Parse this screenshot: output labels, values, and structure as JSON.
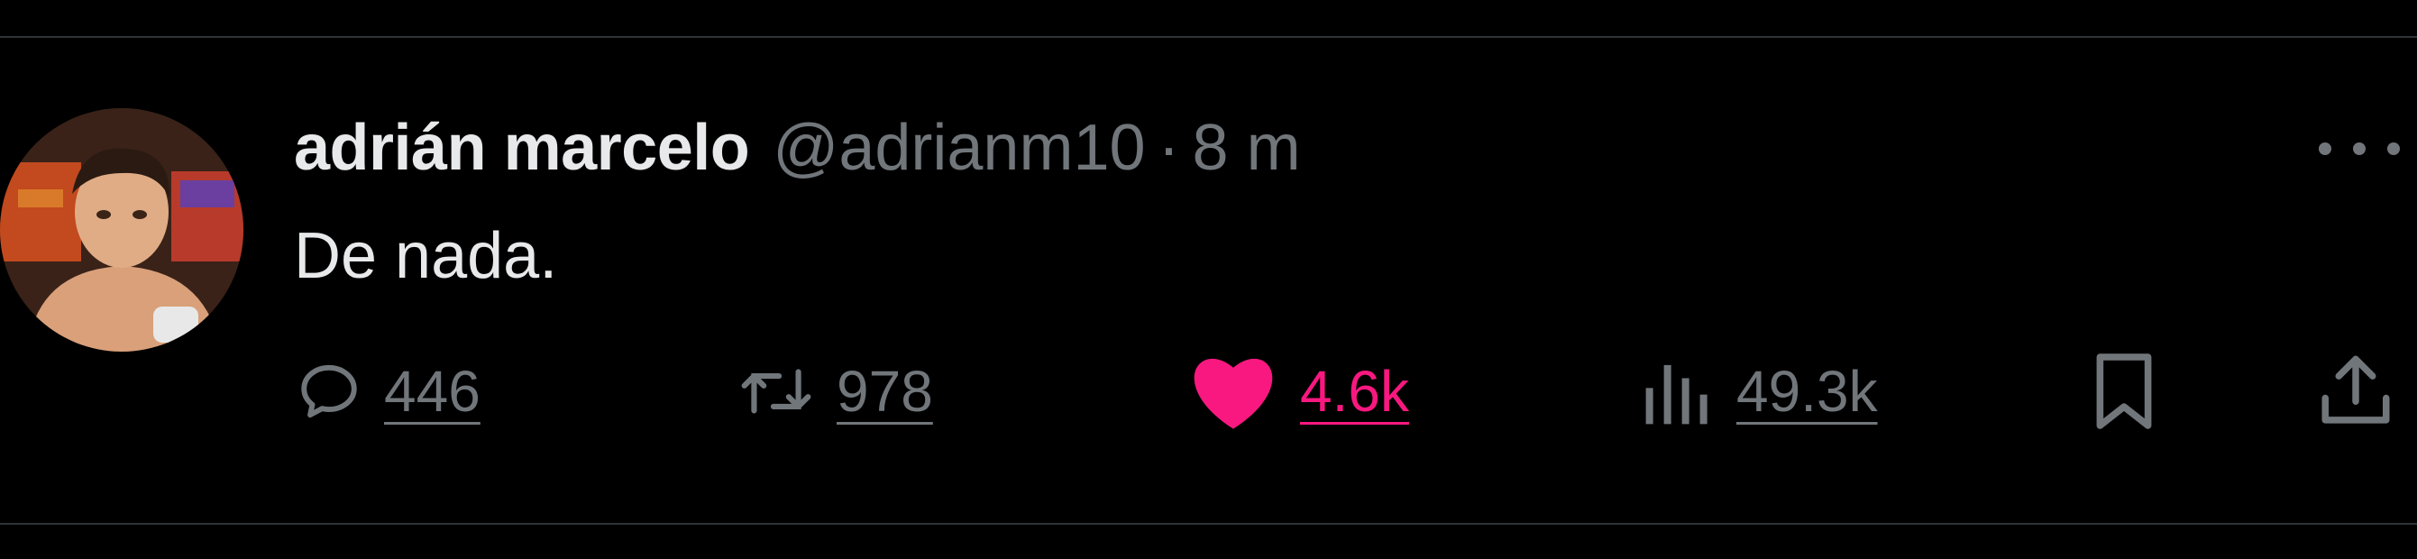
{
  "tweet": {
    "author": {
      "display_name": "adrián marcelo",
      "handle": "@adrianm10",
      "separator": "·",
      "time": "8 m"
    },
    "text": "De nada.",
    "actions": {
      "replies": "446",
      "reposts": "978",
      "likes": "4.6k",
      "views": "49.3k"
    },
    "liked": true
  },
  "colors": {
    "background": "#000000",
    "text_primary": "#e7e9ea",
    "text_secondary": "#71767b",
    "like_active": "#f91880",
    "divider": "#2f3336"
  },
  "icons": {
    "reply": "reply-icon",
    "repost": "repost-icon",
    "like": "heart-icon",
    "views": "views-icon",
    "bookmark": "bookmark-icon",
    "share": "share-icon",
    "more": "more-icon"
  }
}
